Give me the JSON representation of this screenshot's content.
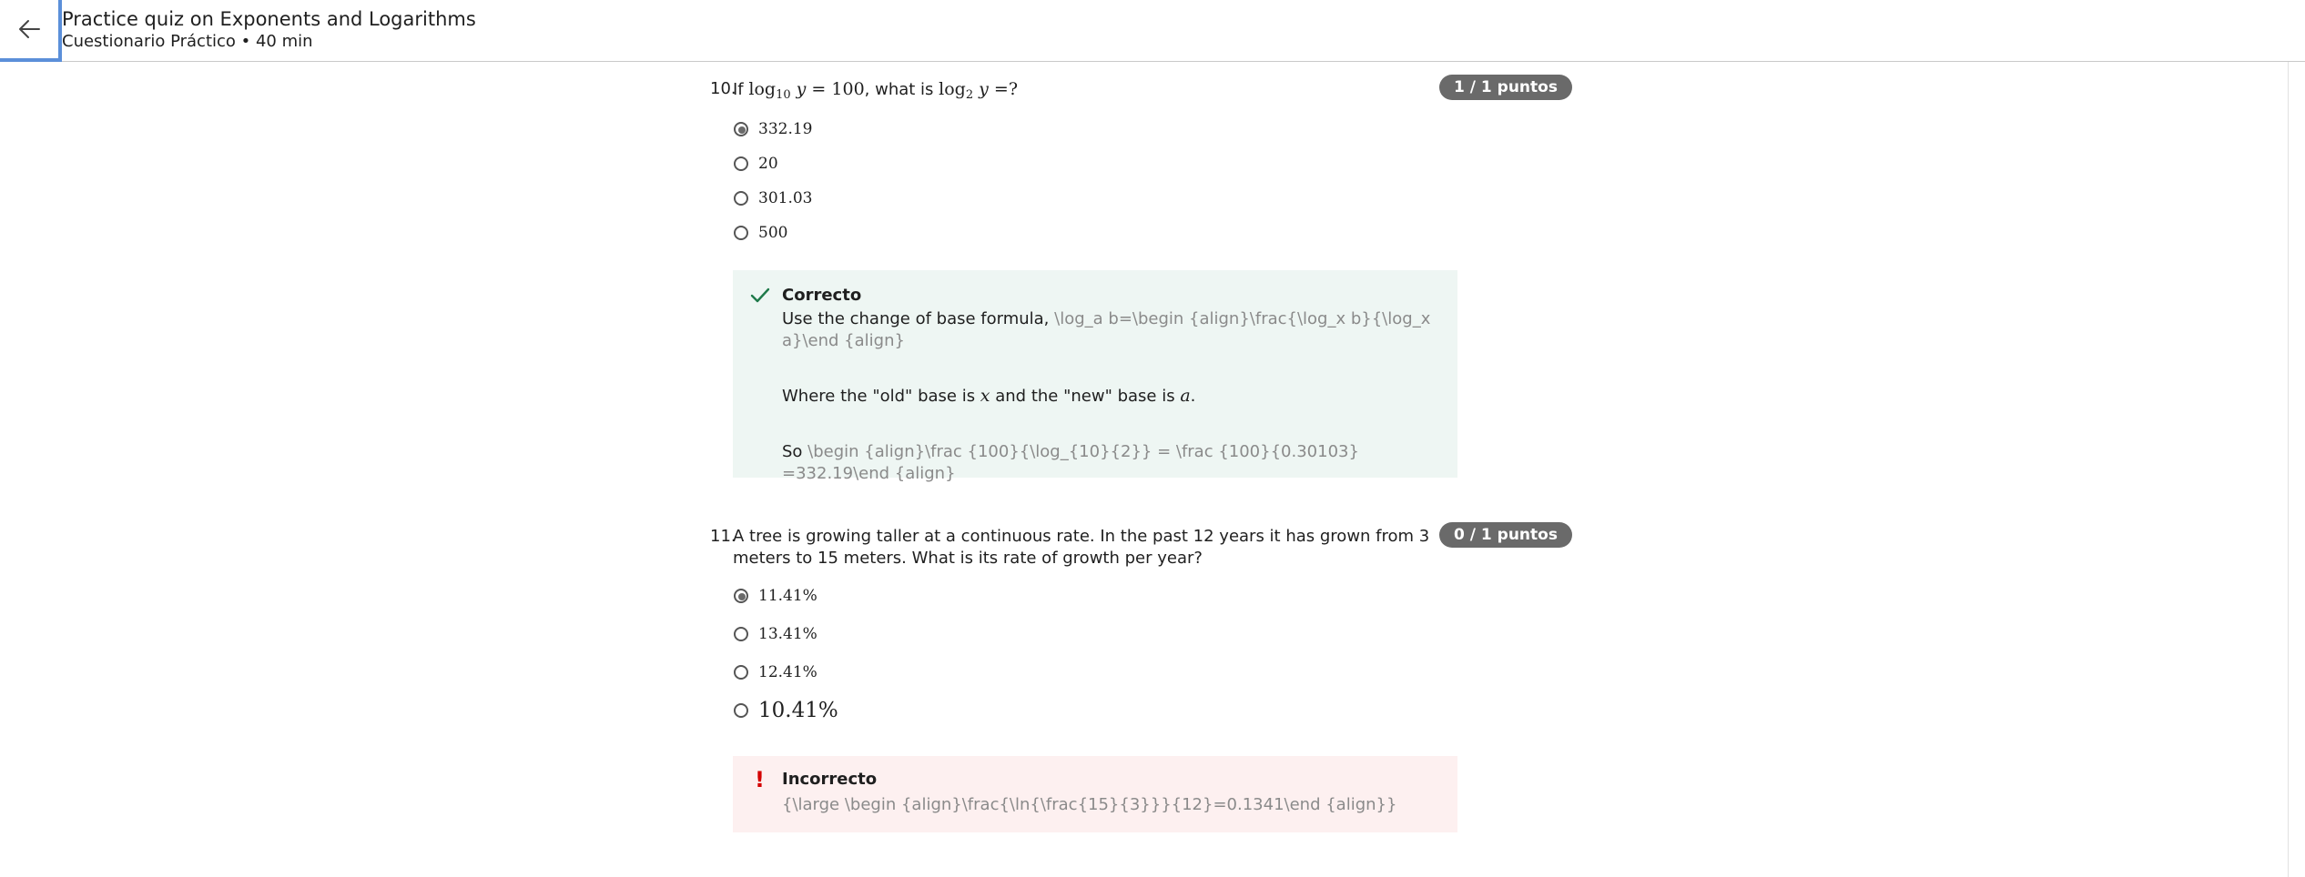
{
  "header": {
    "title": "Practice quiz on Exponents and Logarithms",
    "subtitle": "Cuestionario Práctico • 40 min"
  },
  "q10": {
    "number": "10.",
    "text_prefix": "If ",
    "text_middle": ", what is ",
    "text_suffix": "?",
    "points": "1 / 1 puntos",
    "options": [
      {
        "label": "332.19",
        "selected": true
      },
      {
        "label": "20",
        "selected": false
      },
      {
        "label": "301.03",
        "selected": false
      },
      {
        "label": "500",
        "selected": false
      }
    ],
    "feedback": {
      "status": "Correcto",
      "line1": "Use the change of base formula, ",
      "line1_code": "\\log_a b=\\begin {align}\\frac{\\log_x b}{\\log_x a}\\end {align}",
      "line2_a": "Where the \"old\" base is ",
      "line2_b": " and the \"new\" base is ",
      "line2_c": ".",
      "line3": "So ",
      "line3_code": "\\begin {align}\\frac {100}{\\log_{10}{2}} = \\frac {100}{0.30103} =332.19\\end {align}"
    }
  },
  "q11": {
    "number": "11.",
    "text": "A tree is growing taller at a continuous rate. In the past 12 years it has grown from 3 meters to 15 meters. What is its rate of growth per year?",
    "points": "0 / 1 puntos",
    "options": [
      {
        "label": "11.41%",
        "selected": true
      },
      {
        "label": "13.41%",
        "selected": false
      },
      {
        "label": "12.41%",
        "selected": false
      },
      {
        "label": "10.41%",
        "selected": false
      }
    ],
    "feedback": {
      "status": "Incorrecto",
      "code": "{\\large \\begin {align}\\frac{\\ln{\\frac{15}{3}}}{12}=0.1341\\end {align}}"
    }
  },
  "colors": {
    "points_badge": "#6a6a6a",
    "correct_bg": "#eef6f3",
    "incorrect_bg": "#fdf0f0",
    "check": "#1f7a4a",
    "exclamation": "#d40000",
    "focus_outline": "#5b8fd9"
  },
  "icons": {
    "back": "arrow-left-icon",
    "correct": "checkmark-icon",
    "incorrect": "exclamation-icon"
  }
}
